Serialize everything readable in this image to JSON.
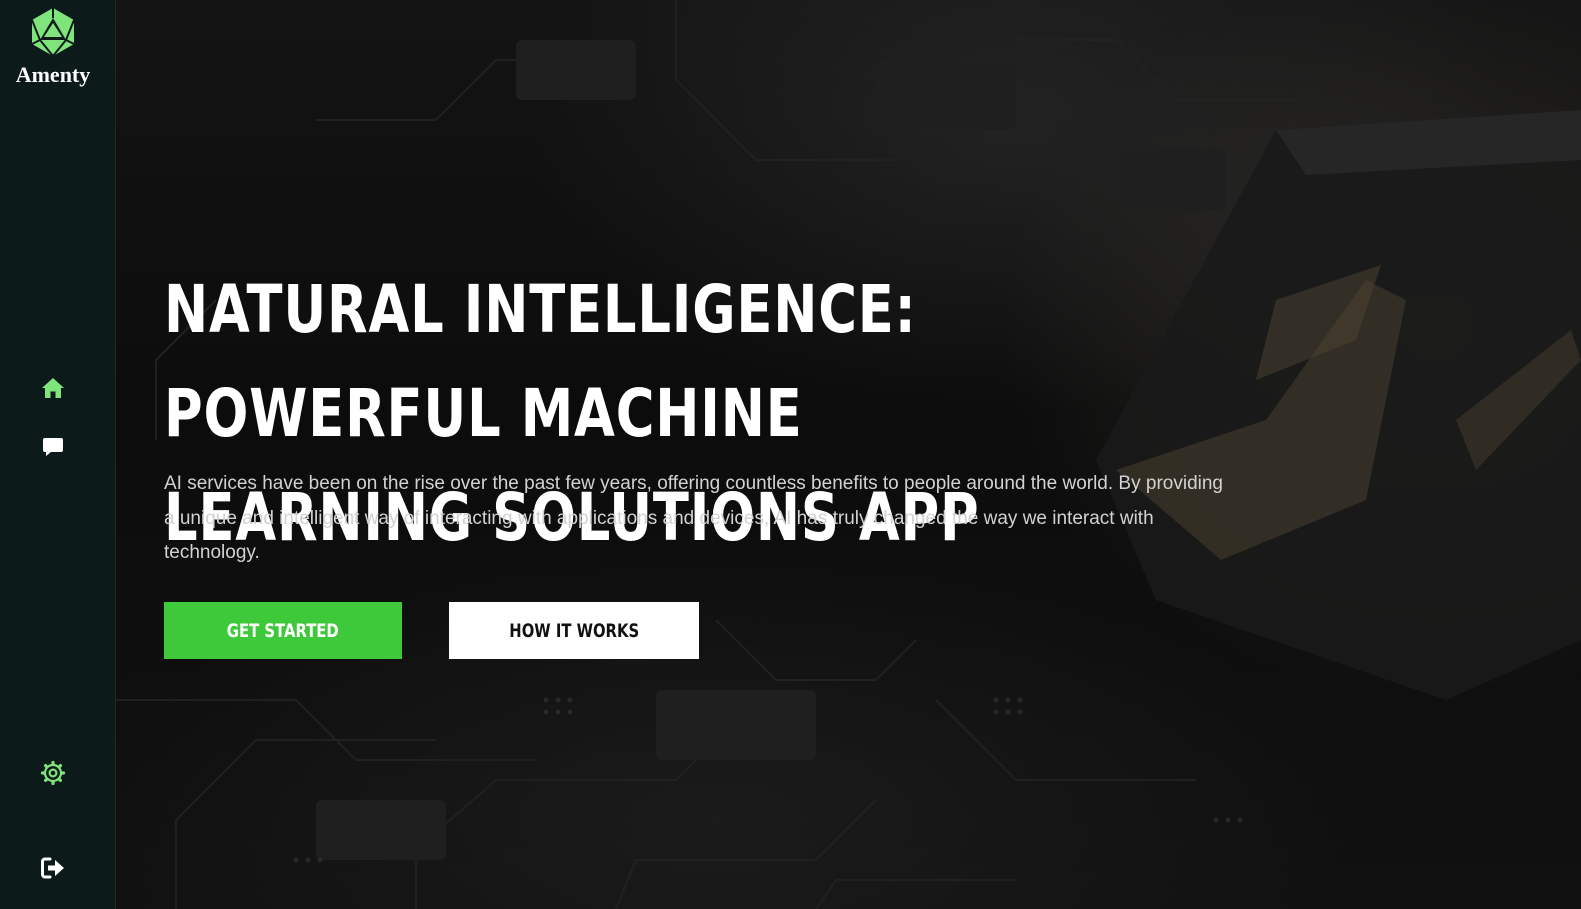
{
  "brand": {
    "name": "Amenty",
    "logo_icon": "d20-dice-icon",
    "accent_color": "#7ee47b"
  },
  "sidebar": {
    "items": [
      {
        "icon": "home-icon",
        "color": "#7ee47b"
      },
      {
        "icon": "chat-bubble-icon",
        "color": "#ffffff"
      },
      {
        "icon": "gear-icon",
        "color": "#7ee47b"
      },
      {
        "icon": "logout-icon",
        "color": "#ffffff"
      }
    ]
  },
  "hero": {
    "headline": "NATURAL INTELLIGENCE: POWERFUL MACHINE LEARNING SOLUTIONS APP",
    "description": "AI services have been on the rise over the past few years, offering countless benefits to people around the world. By providing a unique and intelligent way of interacting with applications and devices, AI has truly changed the way we interact with technology.",
    "primary_button": "GET STARTED",
    "secondary_button": "HOW IT WORKS",
    "primary_color": "#3ec93b",
    "background_motif": "circuit-board-ai-chip"
  }
}
